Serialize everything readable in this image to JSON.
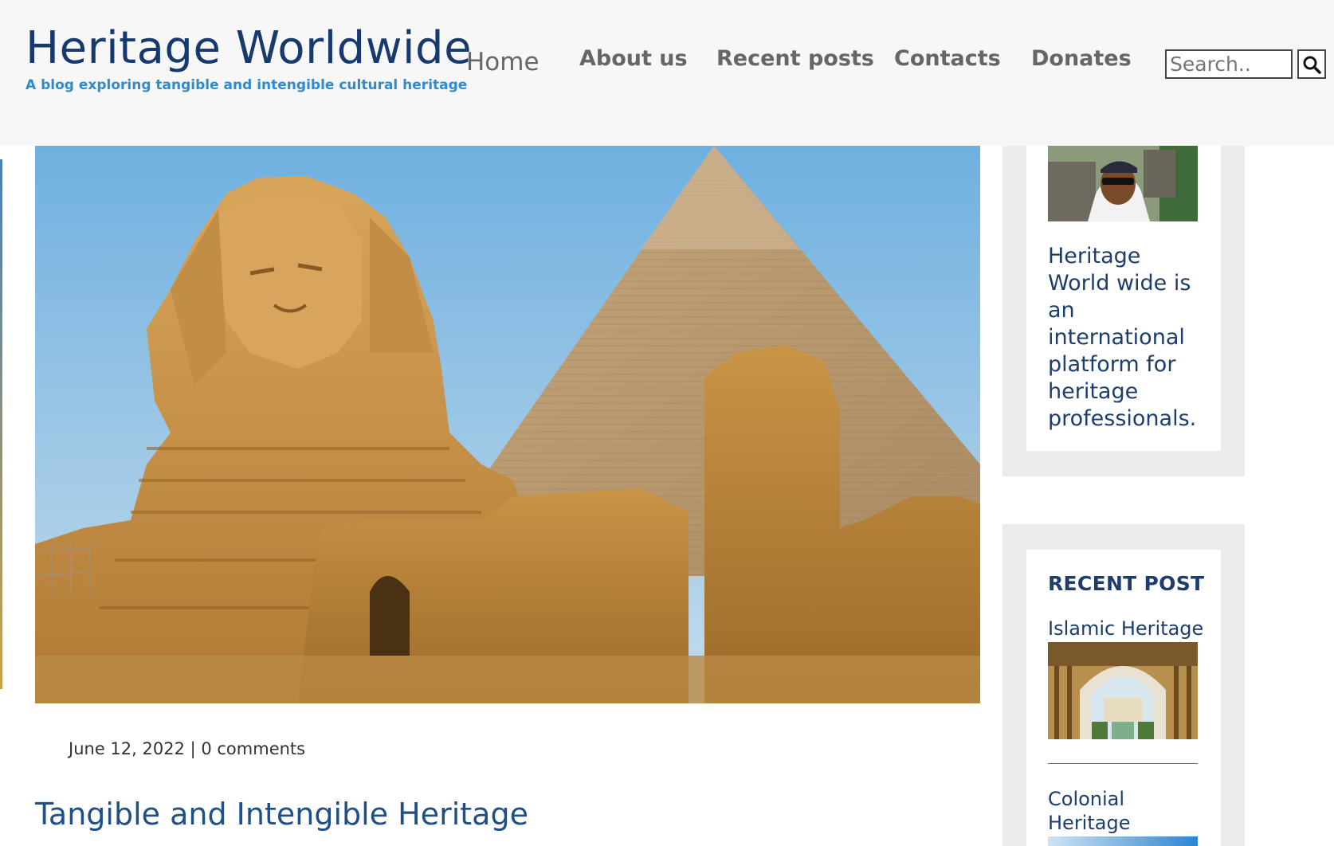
{
  "header": {
    "site_title": "Heritage Worldwide",
    "tagline": "A blog exploring tangible and intengible cultural heritage",
    "search_placeholder": "Search.."
  },
  "nav": {
    "items": [
      {
        "label": "Home"
      },
      {
        "label": "About us"
      },
      {
        "label": "Recent posts"
      },
      {
        "label": "Contacts"
      },
      {
        "label": "Donates"
      }
    ]
  },
  "post": {
    "meta": "June 12, 2022 | 0 comments",
    "title": "Tangible and Intengible Heritage"
  },
  "sidebar": {
    "about_text": "Heritage World wide is an international platform for heritage professionals.",
    "recent_heading": "RECENT POST",
    "recent_posts": [
      {
        "title": "Islamic Heritage"
      },
      {
        "title": "Colonial Heritage"
      }
    ]
  },
  "icons": {
    "search": "search-icon"
  }
}
